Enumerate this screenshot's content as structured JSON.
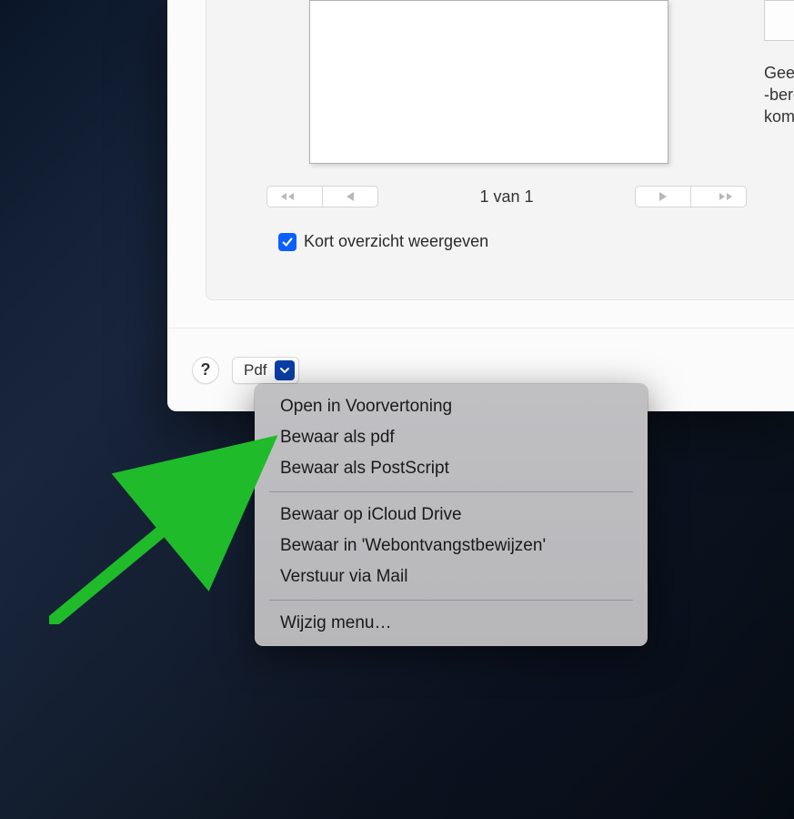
{
  "sideText": {
    "l1": "Geef pa",
    "l2": "-bereik",
    "l3": "komma"
  },
  "pager": {
    "label": "1 van 1"
  },
  "checkbox": {
    "label": "Kort overzicht weergeven",
    "checked": true
  },
  "help": {
    "label": "?"
  },
  "pdfButton": {
    "label": "Pdf"
  },
  "menu": {
    "sec1": [
      {
        "label": "Open in Voorvertoning"
      },
      {
        "label": "Bewaar als pdf"
      },
      {
        "label": "Bewaar als PostScript"
      }
    ],
    "sec2": [
      {
        "label": "Bewaar op iCloud Drive"
      },
      {
        "label": "Bewaar in 'Webontvangstbewijzen'"
      },
      {
        "label": "Verstuur via Mail"
      }
    ],
    "sec3": [
      {
        "label": "Wijzig menu…"
      }
    ]
  }
}
